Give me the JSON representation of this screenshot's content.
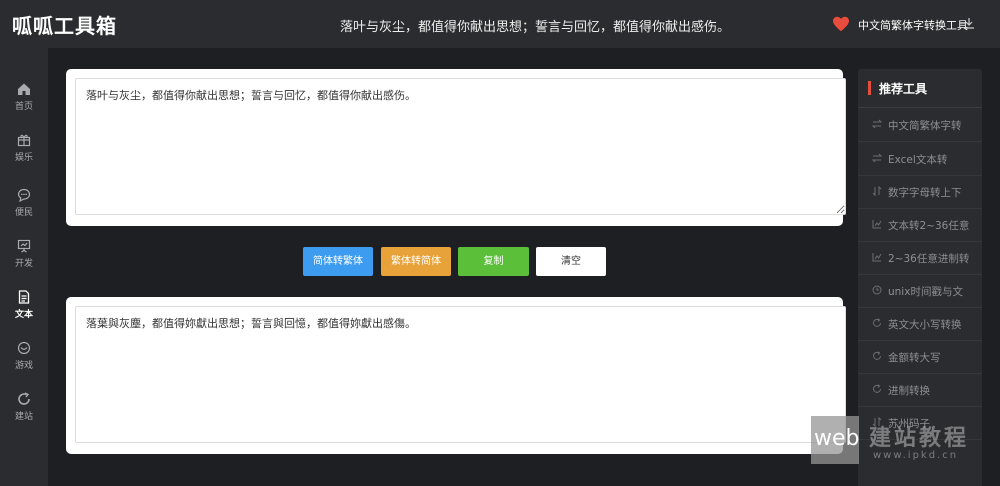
{
  "app": {
    "logo": "呱呱工具箱",
    "slogan": "落叶与灰尘，都值得你献出思想；誓言与回忆，都值得你献出感伤。",
    "current_tool": "中文简繁体字转换工具"
  },
  "sidebar": {
    "items": [
      {
        "label": "首页",
        "icon": "home-icon"
      },
      {
        "label": "娱乐",
        "icon": "gift-icon"
      },
      {
        "label": "便民",
        "icon": "chat-icon"
      },
      {
        "label": "开发",
        "icon": "presentation-icon"
      },
      {
        "label": "文本",
        "icon": "document-icon",
        "active": true
      },
      {
        "label": "游戏",
        "icon": "game-icon"
      },
      {
        "label": "建站",
        "icon": "refresh-icon"
      }
    ]
  },
  "editor": {
    "input_text": "落叶与灰尘，都值得你献出思想；誓言与回忆，都值得你献出感伤。",
    "output_text": "落葉與灰塵，都值得妳獻出思想；誓言與回憶，都值得妳獻出感傷。"
  },
  "buttons": {
    "to_traditional": "简体转繁体",
    "to_simplified": "繁体转简体",
    "copy": "复制",
    "clear": "清空"
  },
  "recommend": {
    "title": "推荐工具",
    "items": [
      "中文简繁体字转",
      "Excel文本转",
      "数字字母转上下",
      "文本转2~36任意",
      "2~36任意进制转",
      "unix时间戳与文",
      "英文大小写转换",
      "金额转大写",
      "进制转换",
      "苏州码子"
    ]
  },
  "watermark": {
    "badge": "web",
    "name": "建站教程",
    "url": "www.ipkd.cn"
  },
  "colors": {
    "blue": "#3d9cf0",
    "orange": "#e8a23a",
    "green": "#5cbf3a",
    "accent_red": "#e74c3c"
  }
}
